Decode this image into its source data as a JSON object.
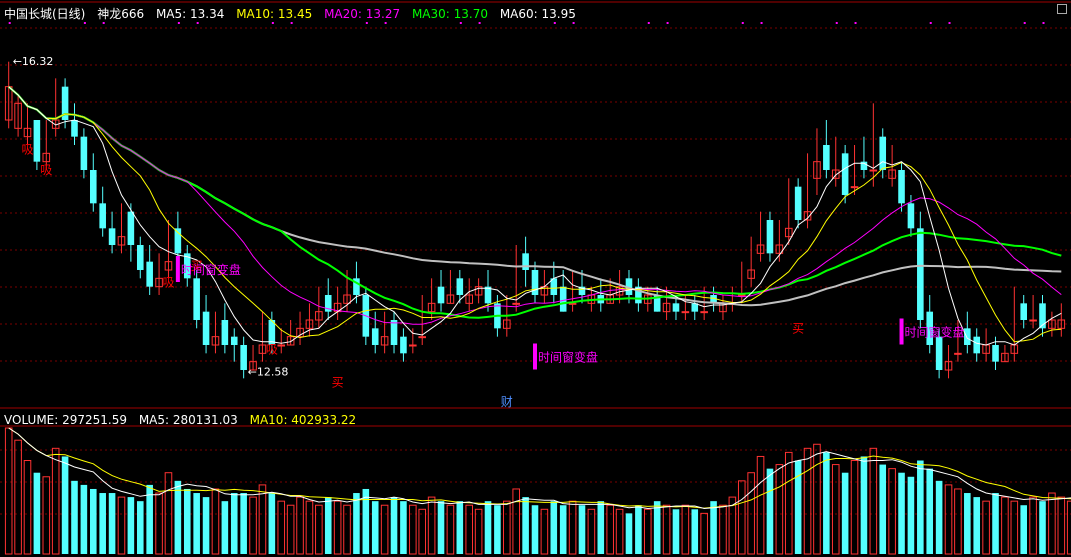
{
  "header": {
    "stock": "中国长城(日线)",
    "indicator": "神龙666",
    "ma5": "MA5: 13.34",
    "ma10": "MA10: 13.45",
    "ma20": "MA20: 13.27",
    "ma30": "MA30: 13.70",
    "ma60": "MA60: 13.95"
  },
  "volume_header": {
    "volume": "VOLUME: 297251.59",
    "ma5": "MA5: 280131.03",
    "ma10": "MA10: 402933.22"
  },
  "colors": {
    "up": "#ff3232",
    "down": "#54ffff",
    "ma5": "#ffffff",
    "ma10": "#ffff00",
    "ma20": "#ff00ff",
    "ma30": "#00ff00",
    "ma60": "#c0c0c0",
    "signal": "#ff0000",
    "window": "#ff00ff"
  },
  "chart_data": {
    "type": "candlestick",
    "price_range": [
      12.3,
      16.8
    ],
    "high_label": "16.32",
    "low_label": "12.58",
    "candles": [
      [
        16.0,
        16.3,
        15.6,
        15.5,
        1
      ],
      [
        15.8,
        15.9,
        15.5,
        15.4,
        1
      ],
      [
        15.5,
        15.8,
        15.4,
        15.3,
        1
      ],
      [
        15.6,
        15.6,
        15.1,
        15.0,
        0
      ],
      [
        15.2,
        15.6,
        15.1,
        15.0,
        1
      ],
      [
        15.6,
        16.1,
        15.5,
        15.4,
        1
      ],
      [
        16.0,
        16.1,
        15.6,
        15.5,
        0
      ],
      [
        15.6,
        15.8,
        15.4,
        15.3,
        0
      ],
      [
        15.4,
        15.5,
        15.0,
        14.9,
        0
      ],
      [
        15.0,
        15.2,
        14.6,
        14.5,
        0
      ],
      [
        14.6,
        14.8,
        14.3,
        14.2,
        0
      ],
      [
        14.3,
        14.5,
        14.1,
        14.0,
        0
      ],
      [
        14.2,
        14.6,
        14.1,
        14.0,
        1
      ],
      [
        14.5,
        14.6,
        14.1,
        13.9,
        0
      ],
      [
        14.1,
        14.2,
        13.8,
        13.7,
        0
      ],
      [
        13.9,
        14.1,
        13.6,
        13.5,
        0
      ],
      [
        13.7,
        14.0,
        13.6,
        13.5,
        1
      ],
      [
        13.9,
        14.4,
        13.8,
        13.7,
        1
      ],
      [
        14.3,
        14.5,
        14.0,
        13.8,
        0
      ],
      [
        14.0,
        14.1,
        13.7,
        13.6,
        0
      ],
      [
        13.7,
        13.8,
        13.2,
        13.1,
        0
      ],
      [
        13.3,
        13.5,
        12.9,
        12.8,
        0
      ],
      [
        13.0,
        13.3,
        12.9,
        12.8,
        1
      ],
      [
        13.2,
        13.4,
        12.9,
        12.8,
        0
      ],
      [
        13.0,
        13.1,
        12.9,
        12.7,
        0
      ],
      [
        12.9,
        13.0,
        12.6,
        12.5,
        0
      ],
      [
        12.7,
        12.9,
        12.6,
        12.6,
        1
      ],
      [
        12.9,
        13.3,
        12.8,
        12.7,
        1
      ],
      [
        13.2,
        13.3,
        12.9,
        12.8,
        0
      ],
      [
        12.9,
        13.1,
        12.9,
        12.8,
        1
      ],
      [
        13.0,
        13.2,
        12.9,
        12.9,
        1
      ],
      [
        13.1,
        13.3,
        13.0,
        12.9,
        1
      ],
      [
        13.2,
        13.4,
        13.1,
        13.0,
        1
      ],
      [
        13.3,
        13.6,
        13.2,
        13.1,
        1
      ],
      [
        13.5,
        13.7,
        13.3,
        13.2,
        0
      ],
      [
        13.4,
        13.6,
        13.3,
        13.2,
        1
      ],
      [
        13.5,
        13.8,
        13.4,
        13.3,
        1
      ],
      [
        13.7,
        13.9,
        13.5,
        13.4,
        0
      ],
      [
        13.5,
        13.6,
        13.0,
        12.9,
        0
      ],
      [
        13.1,
        13.3,
        12.9,
        12.8,
        0
      ],
      [
        13.0,
        13.3,
        12.9,
        12.8,
        1
      ],
      [
        13.2,
        13.3,
        12.9,
        12.8,
        0
      ],
      [
        13.0,
        13.1,
        12.8,
        12.7,
        0
      ],
      [
        12.9,
        13.1,
        12.9,
        12.8,
        1
      ],
      [
        13.0,
        13.5,
        13.0,
        12.9,
        1
      ],
      [
        13.4,
        13.7,
        13.3,
        13.2,
        1
      ],
      [
        13.6,
        13.8,
        13.4,
        13.3,
        0
      ],
      [
        13.5,
        13.8,
        13.4,
        13.4,
        1
      ],
      [
        13.7,
        13.8,
        13.5,
        13.4,
        0
      ],
      [
        13.5,
        13.7,
        13.4,
        13.3,
        1
      ],
      [
        13.6,
        13.7,
        13.5,
        13.4,
        1
      ],
      [
        13.6,
        13.8,
        13.4,
        13.3,
        0
      ],
      [
        13.4,
        13.5,
        13.1,
        13.0,
        0
      ],
      [
        13.2,
        13.5,
        13.1,
        13.0,
        1
      ],
      [
        13.4,
        14.1,
        13.4,
        13.3,
        1
      ],
      [
        14.0,
        14.2,
        13.8,
        13.6,
        0
      ],
      [
        13.8,
        13.9,
        13.5,
        13.4,
        0
      ],
      [
        13.6,
        13.8,
        13.5,
        13.4,
        1
      ],
      [
        13.7,
        13.9,
        13.5,
        13.4,
        0
      ],
      [
        13.6,
        13.8,
        13.3,
        13.3,
        0
      ],
      [
        13.4,
        13.8,
        13.4,
        13.3,
        1
      ],
      [
        13.6,
        13.8,
        13.5,
        13.4,
        0
      ],
      [
        13.5,
        13.6,
        13.4,
        13.3,
        1
      ],
      [
        13.5,
        13.7,
        13.4,
        13.3,
        0
      ],
      [
        13.5,
        13.7,
        13.4,
        13.4,
        1
      ],
      [
        13.6,
        13.8,
        13.5,
        13.4,
        1
      ],
      [
        13.7,
        13.8,
        13.5,
        13.4,
        0
      ],
      [
        13.6,
        13.7,
        13.4,
        13.3,
        0
      ],
      [
        13.5,
        13.6,
        13.4,
        13.3,
        1
      ],
      [
        13.5,
        13.6,
        13.3,
        13.3,
        0
      ],
      [
        13.4,
        13.6,
        13.3,
        13.2,
        1
      ],
      [
        13.4,
        13.5,
        13.3,
        13.2,
        0
      ],
      [
        13.3,
        13.5,
        13.3,
        13.2,
        1
      ],
      [
        13.4,
        13.5,
        13.3,
        13.2,
        0
      ],
      [
        13.3,
        13.6,
        13.3,
        13.2,
        1
      ],
      [
        13.5,
        13.6,
        13.4,
        13.3,
        0
      ],
      [
        13.4,
        13.5,
        13.3,
        13.2,
        1
      ],
      [
        13.4,
        13.6,
        13.4,
        13.3,
        1
      ],
      [
        13.5,
        13.9,
        13.5,
        13.4,
        1
      ],
      [
        13.8,
        14.2,
        13.7,
        13.6,
        1
      ],
      [
        14.1,
        14.5,
        14.0,
        13.9,
        1
      ],
      [
        14.4,
        14.5,
        14.0,
        13.9,
        0
      ],
      [
        14.1,
        14.4,
        14.0,
        13.9,
        1
      ],
      [
        14.3,
        14.9,
        14.2,
        14.1,
        1
      ],
      [
        14.8,
        14.9,
        14.4,
        14.3,
        0
      ],
      [
        14.5,
        15.2,
        14.4,
        14.3,
        1
      ],
      [
        15.1,
        15.5,
        14.9,
        14.7,
        1
      ],
      [
        15.3,
        15.6,
        15.0,
        14.9,
        0
      ],
      [
        15.0,
        15.4,
        14.9,
        14.8,
        1
      ],
      [
        15.2,
        15.3,
        14.7,
        14.6,
        0
      ],
      [
        14.8,
        15.3,
        14.8,
        14.7,
        1
      ],
      [
        15.1,
        15.4,
        15.0,
        14.9,
        0
      ],
      [
        15.0,
        15.8,
        15.0,
        14.8,
        1
      ],
      [
        15.4,
        15.5,
        15.0,
        14.9,
        0
      ],
      [
        15.0,
        15.3,
        14.9,
        14.8,
        1
      ],
      [
        15.0,
        15.1,
        14.6,
        14.5,
        0
      ],
      [
        14.6,
        14.7,
        14.3,
        14.2,
        0
      ],
      [
        14.3,
        14.5,
        13.2,
        13.1,
        0
      ],
      [
        13.3,
        13.5,
        12.9,
        12.8,
        0
      ],
      [
        13.0,
        13.1,
        12.6,
        12.5,
        0
      ],
      [
        12.7,
        12.9,
        12.6,
        12.5,
        1
      ],
      [
        12.8,
        13.2,
        12.8,
        12.7,
        1
      ],
      [
        13.1,
        13.3,
        12.9,
        12.8,
        0
      ],
      [
        13.0,
        13.1,
        12.8,
        12.7,
        0
      ],
      [
        12.9,
        13.1,
        12.8,
        12.7,
        1
      ],
      [
        12.9,
        13.0,
        12.7,
        12.6,
        0
      ],
      [
        12.8,
        12.9,
        12.7,
        12.7,
        1
      ],
      [
        12.9,
        13.6,
        12.8,
        12.7,
        1
      ],
      [
        13.4,
        13.5,
        13.2,
        13.1,
        0
      ],
      [
        13.2,
        13.5,
        13.2,
        13.1,
        1
      ],
      [
        13.4,
        13.5,
        13.1,
        13.0,
        0
      ],
      [
        13.2,
        13.3,
        13.1,
        13.0,
        1
      ],
      [
        13.2,
        13.4,
        13.1,
        13.0,
        1
      ]
    ],
    "volume_range": [
      0,
      310000
    ],
    "volumes": [
      310,
      280,
      230,
      200,
      190,
      260,
      240,
      180,
      170,
      160,
      150,
      150,
      140,
      140,
      130,
      170,
      150,
      200,
      180,
      160,
      150,
      140,
      160,
      130,
      150,
      150,
      140,
      170,
      150,
      130,
      120,
      140,
      130,
      120,
      140,
      130,
      120,
      150,
      160,
      130,
      120,
      140,
      130,
      120,
      110,
      140,
      130,
      120,
      130,
      120,
      110,
      130,
      120,
      130,
      160,
      140,
      120,
      110,
      130,
      120,
      130,
      120,
      110,
      130,
      120,
      110,
      100,
      120,
      110,
      130,
      120,
      110,
      120,
      110,
      100,
      130,
      120,
      140,
      180,
      200,
      240,
      210,
      220,
      250,
      230,
      260,
      270,
      250,
      220,
      200,
      230,
      240,
      260,
      220,
      210,
      200,
      190,
      230,
      210,
      180,
      170,
      160,
      150,
      140,
      130,
      150,
      140,
      130,
      120,
      140,
      130,
      150,
      140,
      130,
      120,
      110
    ],
    "markers": {
      "high_price": 16.32,
      "low_price": 12.58,
      "signals": [
        {
          "idx": 2,
          "price": 15.2,
          "text": "吸"
        },
        {
          "idx": 4,
          "price": 14.95,
          "text": "吸"
        },
        {
          "idx": 17,
          "price": 13.6,
          "text": "吸"
        },
        {
          "idx": 20,
          "price": 13.8,
          "text": "买"
        },
        {
          "idx": 28,
          "price": 12.8,
          "text": "吸"
        },
        {
          "idx": 35,
          "price": 12.4,
          "text": "买"
        },
        {
          "idx": 84,
          "price": 13.05,
          "text": "买"
        },
        {
          "idx": 126,
          "price": 12.6,
          "text": "吸"
        },
        {
          "idx": 140,
          "price": 12.8,
          "text": "买"
        }
      ],
      "window_text": "时间窗变盘",
      "windows": [
        {
          "idx": 18,
          "price": 13.8
        },
        {
          "idx": 56,
          "price": 12.75
        },
        {
          "idx": 95,
          "price": 13.05
        },
        {
          "idx": 133,
          "price": 12.45
        }
      ],
      "fin_text": "财",
      "fin_idx": 53
    }
  }
}
